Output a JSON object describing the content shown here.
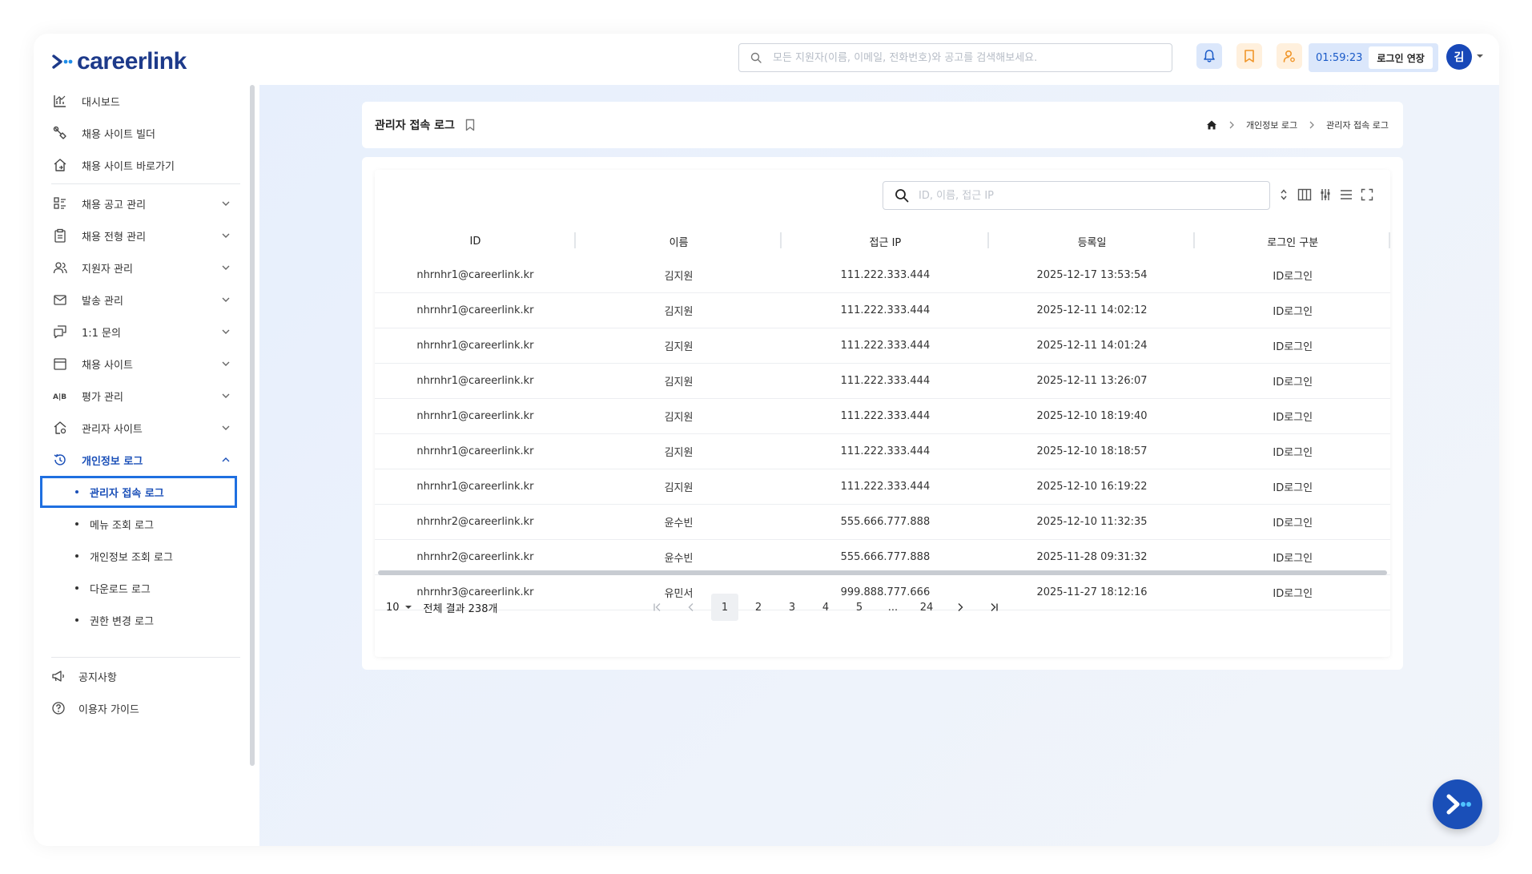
{
  "brand": {
    "name": "careerlink",
    "primary_color": "#1d3a8a",
    "accent_color": "#1f6fe0"
  },
  "header": {
    "search_placeholder": "모든 지원자(이름, 이메일, 전화번호)와 공고를 검색해보세요.",
    "icons": [
      "bell-icon",
      "bookmark-icon",
      "user-icon"
    ],
    "timer": "01:59:23",
    "extend_label": "로그인 연장",
    "avatar_initial": "김"
  },
  "sidebar": {
    "items": [
      {
        "label": "대시보드",
        "icon": "chart-icon",
        "expandable": false
      },
      {
        "label": "채용 사이트 빌더",
        "icon": "tool-icon",
        "expandable": false
      },
      {
        "label": "채용 사이트 바로가기",
        "icon": "home-link-icon",
        "expandable": false
      },
      {
        "label": "채용 공고 관리",
        "icon": "list-icon",
        "expandable": true
      },
      {
        "label": "채용 전형 관리",
        "icon": "clipboard-icon",
        "expandable": true
      },
      {
        "label": "지원자 관리",
        "icon": "users-icon",
        "expandable": true
      },
      {
        "label": "발송 관리",
        "icon": "mail-icon",
        "expandable": true
      },
      {
        "label": "1:1 문의",
        "icon": "chat-icon",
        "expandable": true
      },
      {
        "label": "채용 사이트",
        "icon": "calendar-icon",
        "expandable": true
      },
      {
        "label": "평가 관리",
        "icon": "ab-icon",
        "expandable": true
      },
      {
        "label": "관리자 사이트",
        "icon": "home-settings-icon",
        "expandable": true
      },
      {
        "label": "개인정보 로그",
        "icon": "history-icon",
        "expandable": true,
        "open": true
      }
    ],
    "sub_items": [
      "관리자 접속 로그",
      "메뉴 조회 로그",
      "개인정보 조회 로그",
      "다운로드 로그",
      "권한 변경 로그"
    ],
    "active_sub": "관리자 접속 로그",
    "footer": [
      {
        "label": "공지사항",
        "icon": "megaphone-icon"
      },
      {
        "label": "이용자 가이드",
        "icon": "help-icon"
      }
    ]
  },
  "page": {
    "title": "관리자 접속 로그",
    "breadcrumb": [
      "개인정보 로그",
      "관리자 접속 로그"
    ]
  },
  "table": {
    "search_placeholder": "ID, 이름, 접근 IP",
    "columns": [
      "ID",
      "이름",
      "접근 IP",
      "등록일",
      "로그인 구분"
    ],
    "rows": [
      [
        "nhrnhr1@careerlink.kr",
        "김지원",
        "111.222.333.444",
        "2025-12-17 13:53:54",
        "ID로그인"
      ],
      [
        "nhrnhr1@careerlink.kr",
        "김지원",
        "111.222.333.444",
        "2025-12-11 14:02:12",
        "ID로그인"
      ],
      [
        "nhrnhr1@careerlink.kr",
        "김지원",
        "111.222.333.444",
        "2025-12-11 14:01:24",
        "ID로그인"
      ],
      [
        "nhrnhr1@careerlink.kr",
        "김지원",
        "111.222.333.444",
        "2025-12-11 13:26:07",
        "ID로그인"
      ],
      [
        "nhrnhr1@careerlink.kr",
        "김지원",
        "111.222.333.444",
        "2025-12-10 18:19:40",
        "ID로그인"
      ],
      [
        "nhrnhr1@careerlink.kr",
        "김지원",
        "111.222.333.444",
        "2025-12-10 18:18:57",
        "ID로그인"
      ],
      [
        "nhrnhr1@careerlink.kr",
        "김지원",
        "111.222.333.444",
        "2025-12-10 16:19:22",
        "ID로그인"
      ],
      [
        "nhrnhr2@careerlink.kr",
        "윤수빈",
        "555.666.777.888",
        "2025-12-10 11:32:35",
        "ID로그인"
      ],
      [
        "nhrnhr2@careerlink.kr",
        "윤수빈",
        "555.666.777.888",
        "2025-11-28 09:31:32",
        "ID로그인"
      ],
      [
        "nhrnhr3@careerlink.kr",
        "유민서",
        "999.888.777.666",
        "2025-11-27 18:12:16",
        "ID로그인"
      ]
    ]
  },
  "pagination": {
    "page_size": "10",
    "total_label": "전체 결과 238개",
    "pages": [
      "1",
      "2",
      "3",
      "4",
      "5",
      "...",
      "24"
    ],
    "current": "1"
  }
}
